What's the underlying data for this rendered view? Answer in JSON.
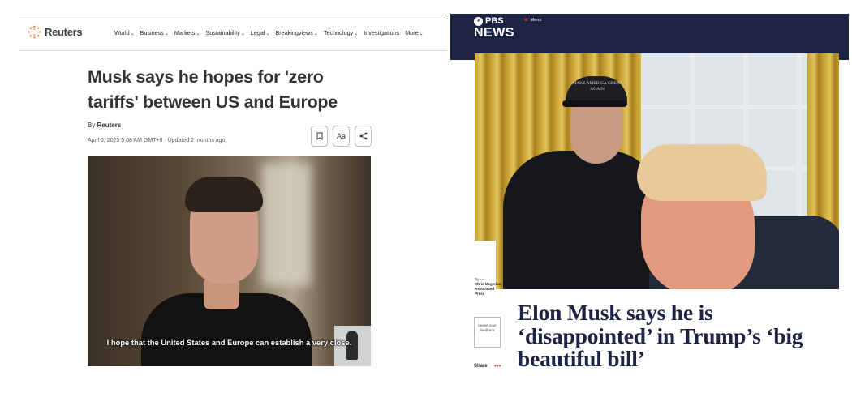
{
  "reuters": {
    "brand": "Reuters",
    "nav": [
      "World",
      "Business",
      "Markets",
      "Sustainability",
      "Legal",
      "Breakingviews",
      "Technology",
      "Investigations",
      "More"
    ],
    "nav_has_dropdown": [
      true,
      true,
      true,
      true,
      true,
      true,
      true,
      false,
      true
    ],
    "headline": "Musk says he hopes for 'zero tariffs' between US and Europe",
    "byline_prefix": "By",
    "byline_author": "Reuters",
    "date": "April 6, 2025 5:08 AM GMT+8 · Updated 2 months ago",
    "actions": {
      "bookmark_icon": "bookmark-icon",
      "font_size_label": "Aa",
      "share_icon": "share-icon"
    },
    "video_caption": "I hope that the United States and Europe can establish a very close."
  },
  "pbs": {
    "brand_top": "PBS",
    "brand_bottom": "NEWS",
    "menu_label": "Menu",
    "photo_cap_text": "MAKE AMERICA GREAT AGAIN",
    "byline_label": "By —",
    "byline_author": "Chris Megerian, Associated Press",
    "feedback_label": "Leave your feedback",
    "share_label": "Share",
    "more_label": "•••",
    "headline": "Elon Musk says he is ‘disappointed’ in Trump’s ‘big beautiful bill’",
    "colors": {
      "header_bg": "#1d2342",
      "accent": "#e04a3f"
    }
  }
}
